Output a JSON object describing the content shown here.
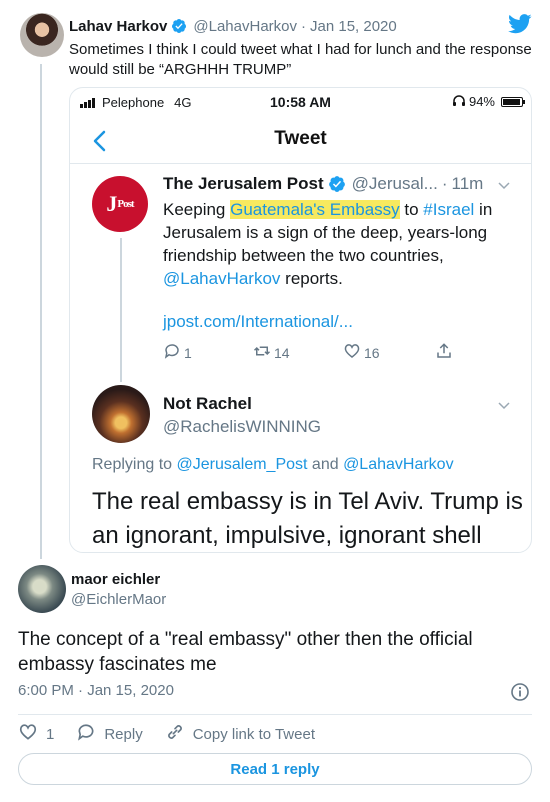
{
  "tweet": {
    "author_name": "Lahav Harkov",
    "author_handle": "@LahavHarkov",
    "separator": "·",
    "date": "Jan 15, 2020",
    "text": "Sometimes I think I could tweet what I had for lunch and the response would still be “ARGHHH TRUMP”",
    "icons": {
      "verified": "verified-badge-icon",
      "brand": "twitter-bird-icon"
    }
  },
  "embedded_screenshot": {
    "status_bar": {
      "carrier": "Pelephone",
      "network": "4G",
      "time": "10:58 AM",
      "battery": "94%"
    },
    "nav_title": "Tweet",
    "quoted_tweet": {
      "logo_text": "JPost",
      "author_name": "The Jerusalem Post",
      "author_handle": "@Jerusal...",
      "separator": "·",
      "age": "11m",
      "text_part1": "Keeping ",
      "highlight": "Guatemala's Embassy",
      "text_part2": " to ",
      "hashtag": "#Israel",
      "text_part3": " in Jerusalem is a sign of the deep, years-long friendship between the two countries, ",
      "mention": "@LahavHarkov",
      "text_part4": " reports.",
      "link": "jpost.com/International/...",
      "replies": "1",
      "retweets": "14",
      "likes": "16"
    },
    "reply_tweet": {
      "author_name": "Not Rachel",
      "author_handle": "@RachelisWINNING",
      "replying_prefix": "Replying to ",
      "replying_mention1": "@Jerusalem_Post",
      "replying_and": " and ",
      "replying_mention2": "@LahavHarkov",
      "text": "The real embassy is in Tel Aviv. Trump is an ignorant, impulsive, ignorant shell"
    }
  },
  "reply": {
    "author_name": "maor eichler",
    "author_handle": "@EichlerMaor",
    "text": "The concept of a \"real embassy\" other then the official embassy fascinates me",
    "timestamp": "6:00 PM · Jan 15, 2020",
    "like_count": "1",
    "reply_label": "Reply",
    "copy_link_label": "Copy link to Tweet",
    "read_replies_label": "Read 1 reply"
  },
  "colors": {
    "accent": "#1b95e0",
    "text": "#14171a",
    "muted": "#657786",
    "highlight": "#f7e95f",
    "jpost_red": "#c8102e"
  }
}
